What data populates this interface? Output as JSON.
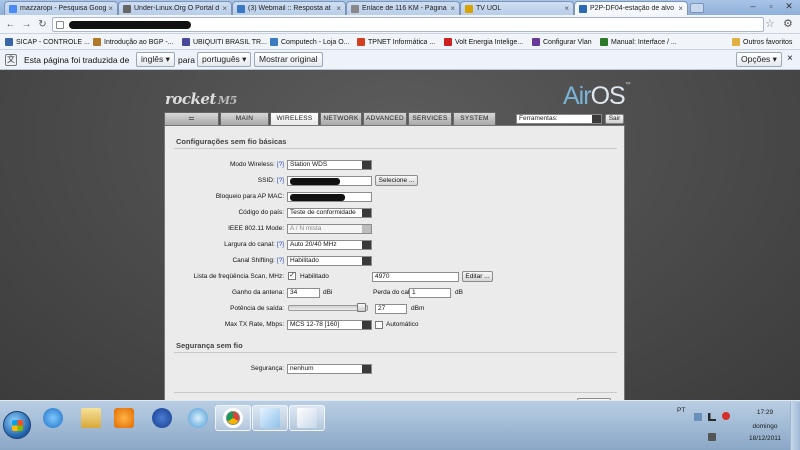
{
  "browser": {
    "tabs": [
      {
        "label": "mazzaropi - Pesquisa Goog",
        "color": "#4c8bf5"
      },
      {
        "label": "Under-Linux.Org O Portal d",
        "color": "#666666"
      },
      {
        "label": "(3) Webmail :: Resposta at",
        "color": "#3a78c2"
      },
      {
        "label": "Enlace de 116 KM - Página",
        "color": "#888888"
      },
      {
        "label": "TV UOL",
        "color": "#d9a300"
      },
      {
        "label": "P2P-DF04-estação de alvo",
        "color": "#2a6ab4"
      }
    ],
    "active_tab_index": 5,
    "bookmarks": [
      {
        "label": "SICAP - CONTROLE ...",
        "color": "#3a66a8"
      },
      {
        "label": "Introdução ao BGP -...",
        "color": "#b07a2a"
      },
      {
        "label": "UBIQUITI BRASIL TR...",
        "color": "#4a4a9a"
      },
      {
        "label": "Computech - Loja O...",
        "color": "#3b7bbf"
      },
      {
        "label": "TPNET Informática ...",
        "color": "#d04020"
      },
      {
        "label": "Volt Energia Intelige...",
        "color": "#cc2222"
      },
      {
        "label": "Configurar Vlan",
        "color": "#6a3a9a"
      },
      {
        "label": "Manual: Interface / ...",
        "color": "#2a7a2a"
      },
      {
        "label": "Outros favoritos",
        "color": "#e0b040"
      }
    ],
    "translate": {
      "prefix": "Esta página foi traduzida de",
      "from_lang": "inglês",
      "to_word": "para",
      "to_lang": "português",
      "show_original": "Mostrar original",
      "options": "Opções"
    }
  },
  "airos": {
    "logo_left": "rocket",
    "logo_left_suffix": "M5",
    "logo_right_a": "Air",
    "logo_right_b": "OS",
    "tabs": [
      "MAIN",
      "WIRELESS",
      "NETWORK",
      "ADVANCED",
      "SERVICES",
      "SYSTEM"
    ],
    "active_tab": "WIRELESS",
    "tools_select": "Ferramentas:",
    "tools_button": "Sair",
    "section_basic": "Configurações sem fio básicas",
    "section_security": "Segurança sem fio",
    "help_mark": "[?]",
    "fields": {
      "wireless_mode_label": "Modo Wireless:",
      "wireless_mode_value": "Station WDS",
      "ssid_label": "SSID:",
      "ssid_button": "Selecione ...",
      "ap_mac_label": "Bloqueio para AP MAC:",
      "country_label": "Código do país:",
      "country_value": "Teste de conformidade",
      "ieee_label": "IEEE 802.11 Mode:",
      "ieee_value": "A / N mista",
      "channel_width_label": "Largura do canal:",
      "channel_width_value": "Auto 20/40 MHz",
      "channel_shifting_label": "Canal Shifting:",
      "channel_shifting_value": "Habilitado",
      "scan_list_label": "Lista de freqüência Scan, MHz:",
      "scan_list_checkbox": "Habilitado",
      "scan_list_value": "4970",
      "scan_list_button": "Editar ...",
      "antenna_gain_label": "Ganho da antena:",
      "antenna_gain_value": "34",
      "antenna_gain_unit": "dBi",
      "cable_loss_label": "Perda do cabo:",
      "cable_loss_value": "1",
      "cable_loss_unit": "dB",
      "output_power_label": "Potência de saída:",
      "output_power_value": "27",
      "output_power_unit": "dBm",
      "max_tx_label": "Max TX Rate, Mbps:",
      "max_tx_value": "MCS 12-78 [160]",
      "auto_label": "Automático",
      "security_label": "Segurança:",
      "security_value": "nenhum"
    }
  },
  "taskbar": {
    "lang": "PT",
    "time": "17:29",
    "day": "domingo",
    "date": "18/12/2011"
  }
}
